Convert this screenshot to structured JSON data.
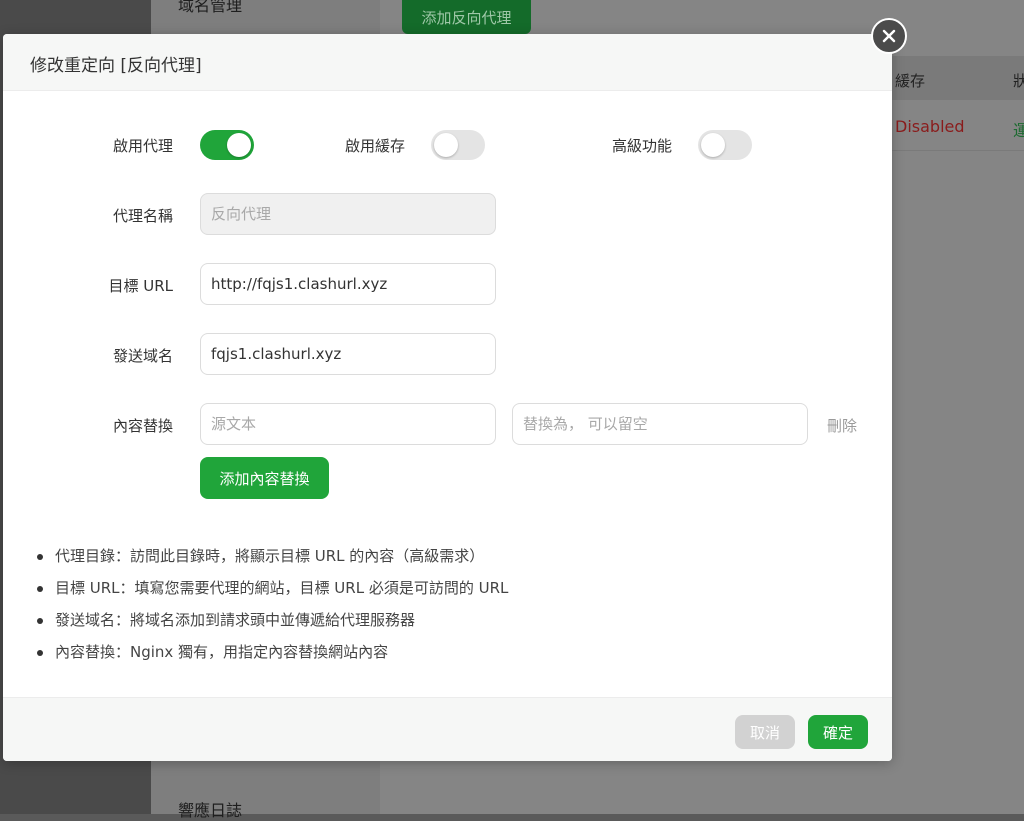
{
  "background": {
    "sidebar_top_item": "域名管理",
    "sidebar_bottom_item": "響應日誌",
    "add_proxy_button": "添加反向代理",
    "table": {
      "headers": [
        "緩存",
        "狀"
      ],
      "row": {
        "cache": "Disabled",
        "status": "運"
      }
    }
  },
  "modal": {
    "title": "修改重定向 [反向代理]",
    "toggles": [
      {
        "label": "啟用代理",
        "on": true
      },
      {
        "label": "啟用緩存",
        "on": false
      },
      {
        "label": "高級功能",
        "on": false
      }
    ],
    "proxy_name": {
      "label": "代理名稱",
      "placeholder": "反向代理",
      "value": ""
    },
    "target_url": {
      "label": "目標 URL",
      "value": "http://fqjs1.clashurl.xyz"
    },
    "send_domain": {
      "label": "發送域名",
      "value": "fqjs1.clashurl.xyz"
    },
    "content_replace": {
      "label": "內容替換",
      "source_placeholder": "源文本",
      "replace_placeholder": "替換為， 可以留空",
      "delete_label": "刪除",
      "add_button": "添加內容替換"
    },
    "notes": [
      "代理目錄：訪問此目錄時，將顯示目標 URL 的內容（高級需求）",
      "目標 URL：填寫您需要代理的網站，目標 URL 必須是可訪問的 URL",
      "發送域名：將域名添加到請求頭中並傳遞給代理服務器",
      "內容替換：Nginx 獨有，用指定內容替換網站內容"
    ],
    "footer": {
      "cancel": "取消",
      "confirm": "確定"
    }
  },
  "colors": {
    "accent": "#20a53a",
    "disabled_text": "#8a1c1c"
  }
}
